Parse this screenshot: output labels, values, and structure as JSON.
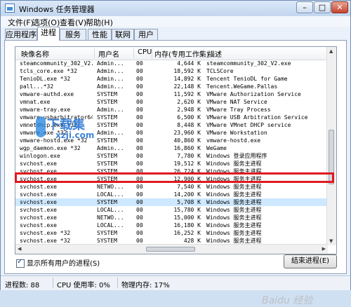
{
  "window": {
    "title": "Windows 任务管理器"
  },
  "menu": [
    "文件(F)",
    "选项(O)",
    "查看(V)",
    "帮助(H)"
  ],
  "tabs": [
    "应用程序",
    "进程",
    "服务",
    "性能",
    "联网",
    "用户"
  ],
  "columns": [
    "映像名称",
    "用户名",
    "CPU",
    "内存(专用工作集)",
    "描述"
  ],
  "processes": [
    [
      "steamcommunity_302_V2.exe",
      "Admin...",
      "00",
      "4,644 K",
      "steamcommunity_302_V2.exe"
    ],
    [
      "tcls_core.exe *32",
      "Admin...",
      "00",
      "18,592 K",
      "TCLSCore"
    ],
    [
      "TenioDL.exe *32",
      "Admin...",
      "00",
      "14,892 K",
      "Tencent TenioDL for Game"
    ],
    [
      "pall...*32",
      "Admin...",
      "00",
      "22,148 K",
      "Tencent.WeGame.Pallas"
    ],
    [
      "vmware-authd.exe",
      "SYSTEM",
      "00",
      "11,592 K",
      "VMware Authorization Service"
    ],
    [
      "vmnat.exe",
      "SYSTEM",
      "00",
      "2,620 K",
      "VMware NAT Service"
    ],
    [
      "vmware-tray.exe",
      "Admin...",
      "00",
      "2,948 K",
      "VMware Tray Process"
    ],
    [
      "vmware-usbarbitrator64...",
      "SYSTEM",
      "00",
      "6,500 K",
      "VMware USB Arbitration Service"
    ],
    [
      "vmnetdhcp.exe *32",
      "SYSTEM",
      "00",
      "8,448 K",
      "VMware VMnet DHCP service"
    ],
    [
      "vmware.exe *32",
      "Admin...",
      "00",
      "23,960 K",
      "VMware Workstation"
    ],
    [
      "vmware-hostd.exe *32",
      "SYSTEM",
      "00",
      "40,860 K",
      "vmware-hostd.exe"
    ],
    [
      "wgp_daemon.exe *32",
      "Admin...",
      "00",
      "16,860 K",
      "WeGame"
    ],
    [
      "winlogon.exe",
      "SYSTEM",
      "00",
      "7,780 K",
      "Windows 登录应用程序"
    ],
    [
      "svchost.exe",
      "SYSTEM",
      "00",
      "19,512 K",
      "Windows 服务主进程"
    ],
    [
      "svchost.exe",
      "SYSTEM",
      "00",
      "26,724 K",
      "Windows 服务主进程"
    ],
    [
      "svchost.exe",
      "SYSTEM",
      "00",
      "12,900 K",
      "Windows 服务主进程"
    ],
    [
      "svchost.exe",
      "NETWO...",
      "00",
      "7,540 K",
      "Windows 服务主进程"
    ],
    [
      "svchost.exe",
      "LOCAL...",
      "00",
      "14,200 K",
      "Windows 服务主进程"
    ],
    [
      "svchost.exe",
      "SYSTEM",
      "00",
      "5,708 K",
      "Windows 服务主进程"
    ],
    [
      "svchost.exe",
      "LOCAL...",
      "00",
      "15,780 K",
      "Windows 服务主进程"
    ],
    [
      "svchost.exe",
      "NETWO...",
      "00",
      "15,000 K",
      "Windows 服务主进程"
    ],
    [
      "svchost.exe",
      "LOCAL...",
      "00",
      "16,180 K",
      "Windows 服务主进程"
    ],
    [
      "svchost.exe *32",
      "SYSTEM",
      "00",
      "16,252 K",
      "Windows 服务主进程"
    ],
    [
      "svchost.exe *32",
      "SYSTEM",
      "00",
      "428 K",
      "Windows 服务主进程"
    ]
  ],
  "show_all_label": "显示所有用户的进程(S)",
  "end_process_label": "结束进程(E)",
  "status": {
    "processes": "进程数: 88",
    "cpu": "CPU 使用率: 0%",
    "memory": "物理内存: 17%"
  },
  "watermark": {
    "title": "下载集",
    "sub": "xzji.com",
    "baidu": "Baidu 经验"
  }
}
